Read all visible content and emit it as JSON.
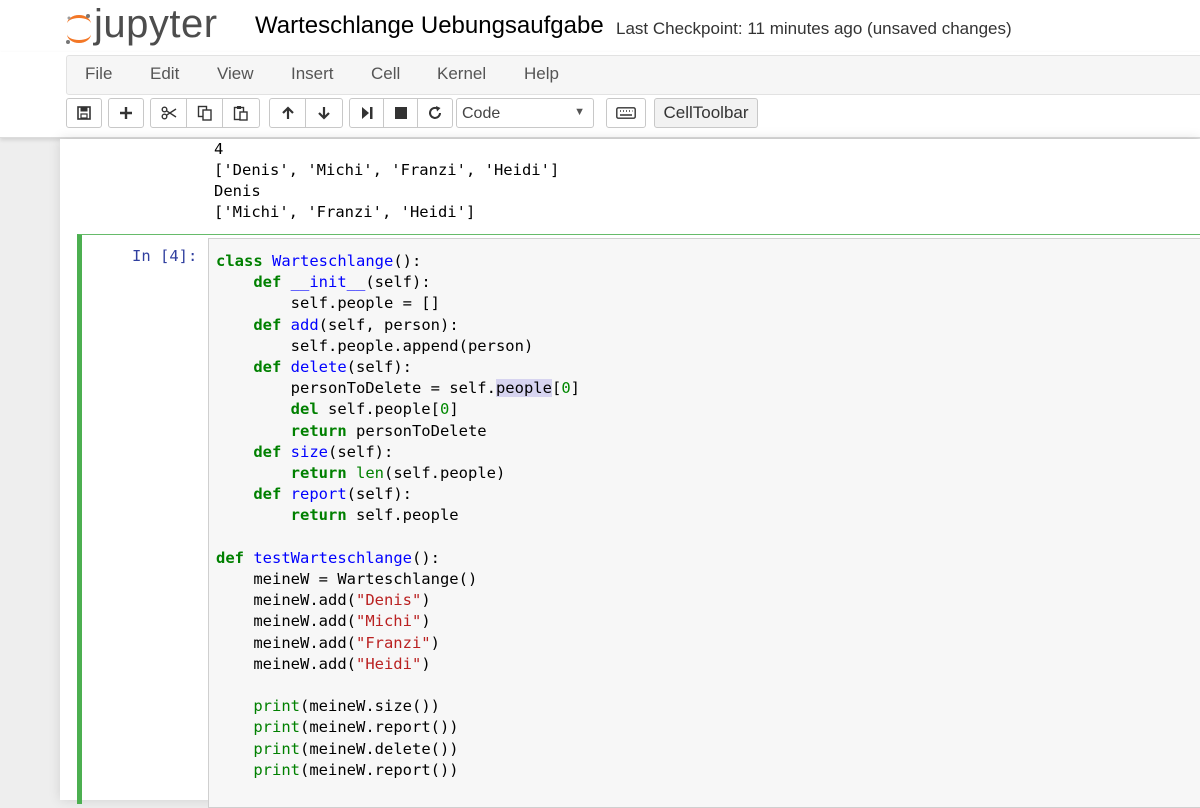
{
  "header": {
    "logo_text": "jupyter",
    "notebook_title": "Warteschlange Uebungsaufgabe",
    "checkpoint_status": "Last Checkpoint: 11 minutes ago (unsaved changes)"
  },
  "menubar": {
    "items": [
      "File",
      "Edit",
      "View",
      "Insert",
      "Cell",
      "Kernel",
      "Help"
    ]
  },
  "toolbar": {
    "buttons": [
      "save-icon",
      "plus-icon",
      "scissors-icon",
      "copy-icon",
      "paste-icon",
      "arrow-up-icon",
      "arrow-down-icon",
      "run-icon",
      "stop-icon",
      "restart-icon",
      "keyboard-icon"
    ],
    "cell_type": "Code",
    "celltoolbar_label": "CellToolbar"
  },
  "output": {
    "lines": [
      "4",
      "['Denis', 'Michi', 'Franzi', 'Heidi']",
      "Denis",
      "['Michi', 'Franzi', 'Heidi']"
    ]
  },
  "cell": {
    "prompt": "In [4]:",
    "code_lines": [
      "class Warteschlange():",
      "    def __init__(self):",
      "        self.people = []",
      "    def add(self, person):",
      "        self.people.append(person)",
      "    def delete(self):",
      "        personToDelete = self.people[0]",
      "        del self.people[0]",
      "        return personToDelete",
      "    def size(self):",
      "        return len(self.people)",
      "    def report(self):",
      "        return self.people",
      "",
      "def testWarteschlange():",
      "    meineW = Warteschlange()",
      "    meineW.add(\"Denis\")",
      "    meineW.add(\"Michi\")",
      "    meineW.add(\"Franzi\")",
      "    meineW.add(\"Heidi\")",
      "",
      "    print(meineW.size())",
      "    print(meineW.report())",
      "    print(meineW.delete())",
      "    print(meineW.report())"
    ]
  },
  "colors": {
    "accent_orange": "#f37726",
    "cell_border_green": "#4caf50",
    "prompt_blue": "#303f9f",
    "keyword_green": "#008000",
    "def_name_blue": "#0000ff",
    "string_red": "#ba2121"
  }
}
